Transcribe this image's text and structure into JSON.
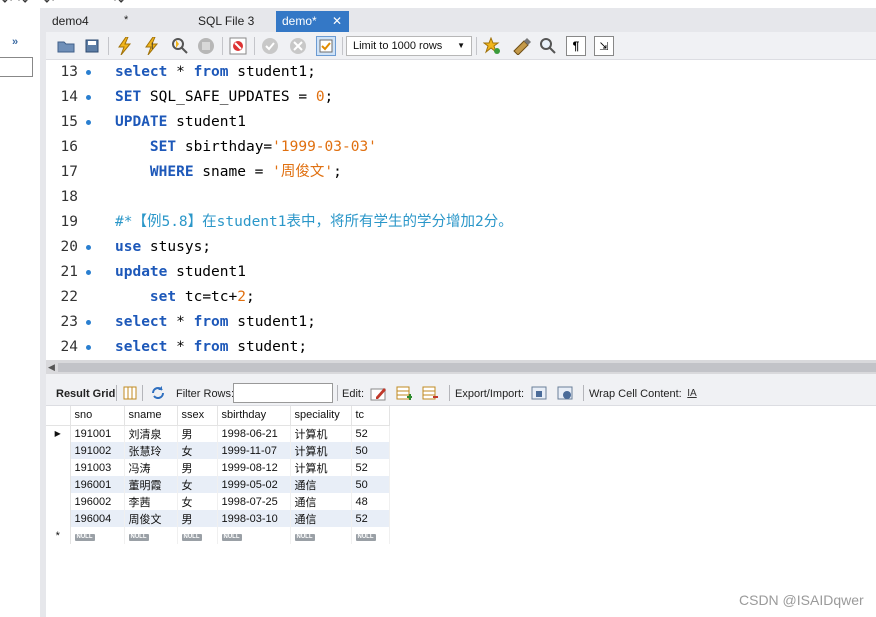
{
  "tabs": [
    {
      "label": "demo4",
      "modified_mark": "*",
      "active": false
    },
    {
      "label": "SQL File 3",
      "active": false
    },
    {
      "label": "demo*",
      "active": true,
      "close_glyph": "✕"
    }
  ],
  "toolbar": {
    "limit_select": "Limit to 1000 rows",
    "icons": [
      "open-folder-icon",
      "save-icon",
      "execute-icon",
      "execute-current-icon",
      "explain-icon",
      "stop-icon",
      "toggle-error-icon",
      "commit-icon",
      "rollback-icon",
      "autocommit-icon",
      "bookmark-icon",
      "beautify-icon",
      "find-icon",
      "invisible-chars-icon",
      "wrap-icon"
    ]
  },
  "editor": {
    "lines": [
      {
        "num": "13",
        "dot": true,
        "tokens": [
          [
            "kw",
            "select"
          ],
          [
            "id",
            " * "
          ],
          [
            "kw",
            "from"
          ],
          [
            "id",
            " student1;"
          ]
        ]
      },
      {
        "num": "14",
        "dot": true,
        "tokens": [
          [
            "kw",
            "SET"
          ],
          [
            "id",
            " SQL_SAFE_UPDATES = "
          ],
          [
            "num",
            "0"
          ],
          [
            "id",
            ";"
          ]
        ]
      },
      {
        "num": "15",
        "dot": true,
        "tokens": [
          [
            "kw",
            "UPDATE"
          ],
          [
            "id",
            " student1"
          ]
        ]
      },
      {
        "num": "16",
        "dot": false,
        "tokens": [
          [
            "id",
            "    "
          ],
          [
            "kw",
            "SET"
          ],
          [
            "id",
            " sbirthday="
          ],
          [
            "str",
            "'1999-03-03'"
          ]
        ]
      },
      {
        "num": "17",
        "dot": false,
        "tokens": [
          [
            "id",
            "    "
          ],
          [
            "kw",
            "WHERE"
          ],
          [
            "id",
            " sname = "
          ],
          [
            "str",
            "'周俊文'"
          ],
          [
            "id",
            ";"
          ]
        ]
      },
      {
        "num": "18",
        "dot": false,
        "tokens": []
      },
      {
        "num": "19",
        "dot": false,
        "tokens": [
          [
            "cmt",
            "#*【例5.8】在student1表中，将所有学生的学分增加2分。"
          ]
        ]
      },
      {
        "num": "20",
        "dot": true,
        "tokens": [
          [
            "kw",
            "use"
          ],
          [
            "id",
            " stusys;"
          ]
        ]
      },
      {
        "num": "21",
        "dot": true,
        "tokens": [
          [
            "kw",
            "update"
          ],
          [
            "id",
            " student1"
          ]
        ]
      },
      {
        "num": "22",
        "dot": false,
        "tokens": [
          [
            "id",
            "    "
          ],
          [
            "kw",
            "set"
          ],
          [
            "id",
            " tc=tc+"
          ],
          [
            "num",
            "2"
          ],
          [
            "id",
            ";"
          ]
        ]
      },
      {
        "num": "23",
        "dot": true,
        "tokens": [
          [
            "kw",
            "select"
          ],
          [
            "id",
            " * "
          ],
          [
            "kw",
            "from"
          ],
          [
            "id",
            " student1;"
          ]
        ]
      },
      {
        "num": "24",
        "dot": true,
        "tokens": [
          [
            "kw",
            "select"
          ],
          [
            "id",
            " * "
          ],
          [
            "kw",
            "from"
          ],
          [
            "id",
            " student;"
          ]
        ]
      }
    ]
  },
  "result_toolbar": {
    "result_grid": "Result Grid",
    "filter_rows": "Filter Rows:",
    "filter_value": "",
    "edit": "Edit:",
    "export_import": "Export/Import:",
    "wrap_cell": "Wrap Cell Content:"
  },
  "grid": {
    "columns": [
      "sno",
      "sname",
      "ssex",
      "sbirthday",
      "speciality",
      "tc"
    ],
    "rows": [
      [
        "191001",
        "刘清泉",
        "男",
        "1998-06-21",
        "计算机",
        "52"
      ],
      [
        "191002",
        "张慧玲",
        "女",
        "1999-11-07",
        "计算机",
        "50"
      ],
      [
        "191003",
        "冯涛",
        "男",
        "1999-08-12",
        "计算机",
        "52"
      ],
      [
        "196001",
        "董明霞",
        "女",
        "1999-05-02",
        "通信",
        "50"
      ],
      [
        "196002",
        "李茜",
        "女",
        "1998-07-25",
        "通信",
        "48"
      ],
      [
        "196004",
        "周俊文",
        "男",
        "1998-03-10",
        "通信",
        "52"
      ]
    ],
    "null_label": "NULL",
    "new_row_marker": "*",
    "current_row_marker": "▶"
  },
  "watermark": "CSDN @ISAIDqwer"
}
